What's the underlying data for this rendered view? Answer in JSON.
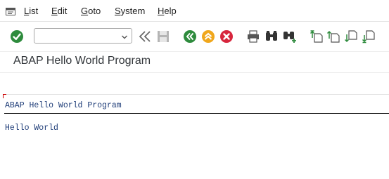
{
  "menu": {
    "items": [
      {
        "key": "L",
        "rest": "ist"
      },
      {
        "key": "E",
        "rest": "dit"
      },
      {
        "key": "G",
        "rest": "oto"
      },
      {
        "key": "S",
        "rest": "ystem"
      },
      {
        "key": "H",
        "rest": "elp"
      }
    ]
  },
  "toolbar": {
    "command_field_value": "",
    "icons": [
      "enter-icon",
      "command-dropdown-icon",
      "collapse-toolbar-icon",
      "save-icon",
      "back-icon",
      "exit-icon",
      "cancel-icon",
      "print-icon",
      "find-icon",
      "find-next-icon",
      "first-page-icon",
      "previous-page-icon",
      "next-page-icon",
      "last-page-icon"
    ]
  },
  "screen": {
    "title": "ABAP Hello World Program"
  },
  "list": {
    "header": "ABAP Hello World Program",
    "lines": [
      "Hello World"
    ]
  },
  "colors": {
    "enter": "#2e8b3d",
    "back": "#2e8b3d",
    "exit": "#f0a71c",
    "cancel": "#d7263d",
    "list_text": "#1f3d78"
  }
}
